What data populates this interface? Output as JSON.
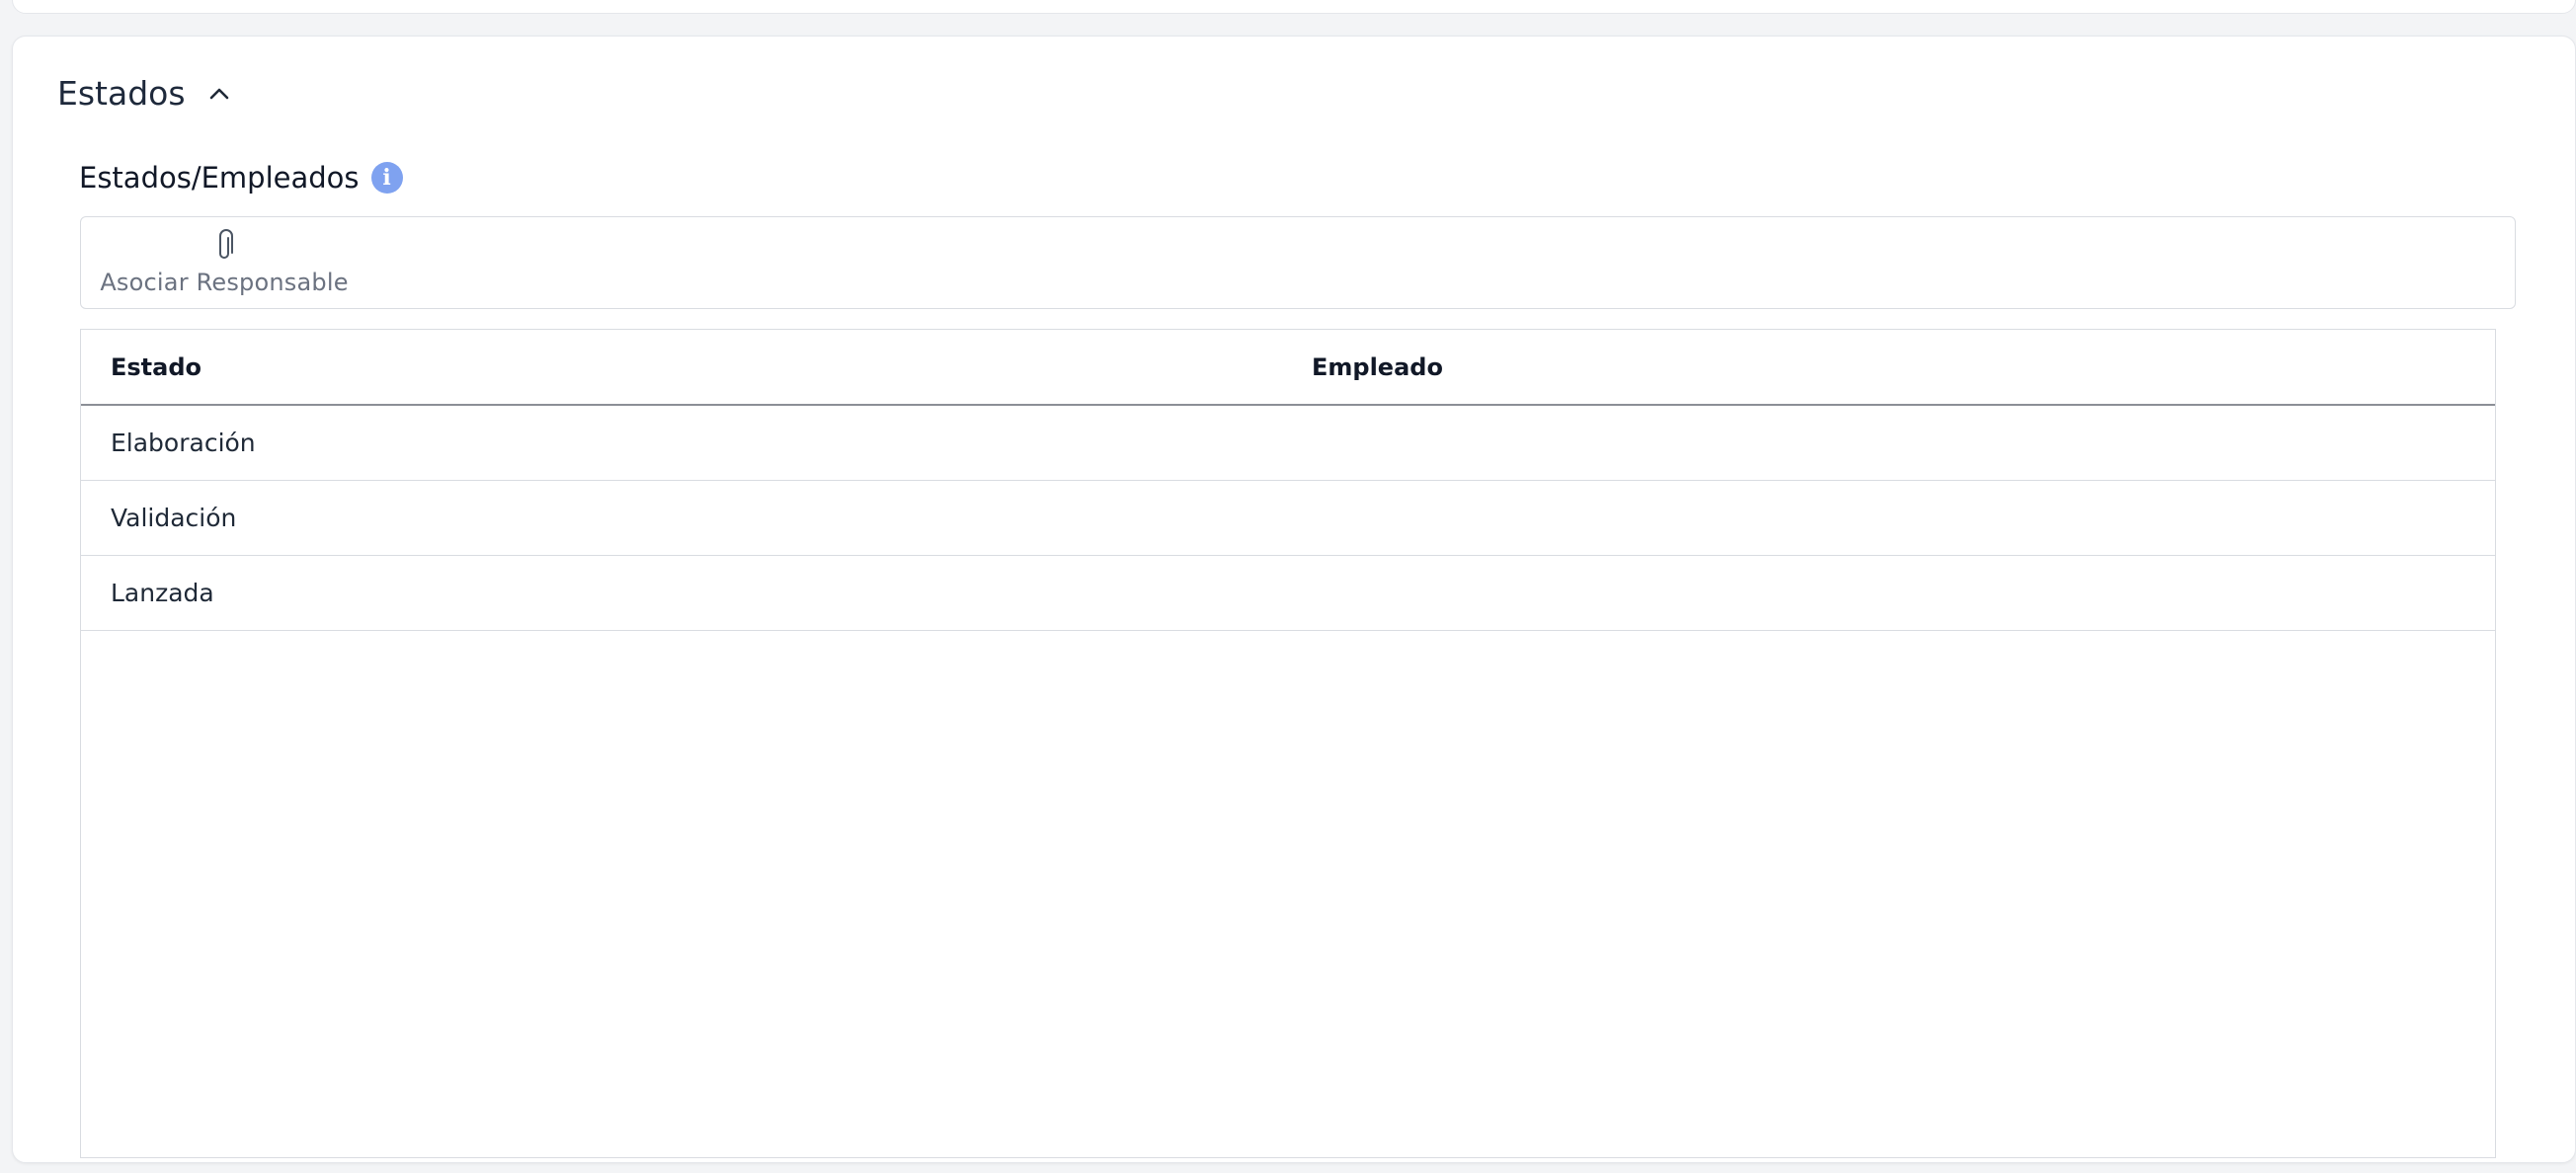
{
  "section": {
    "title": "Estados",
    "chevron_icon": "chevron-up-icon"
  },
  "subsection": {
    "title": "Estados/Empleados",
    "info_icon": "info-icon",
    "info_color": "#7fa2f0"
  },
  "attach": {
    "icon": "paperclip-icon",
    "label": "Asociar Responsable"
  },
  "table": {
    "columns": [
      "Estado",
      "Empleado"
    ],
    "rows": [
      {
        "estado": "Elaboración",
        "empleado": ""
      },
      {
        "estado": "Validación",
        "empleado": ""
      },
      {
        "estado": "Lanzada",
        "empleado": ""
      }
    ]
  }
}
